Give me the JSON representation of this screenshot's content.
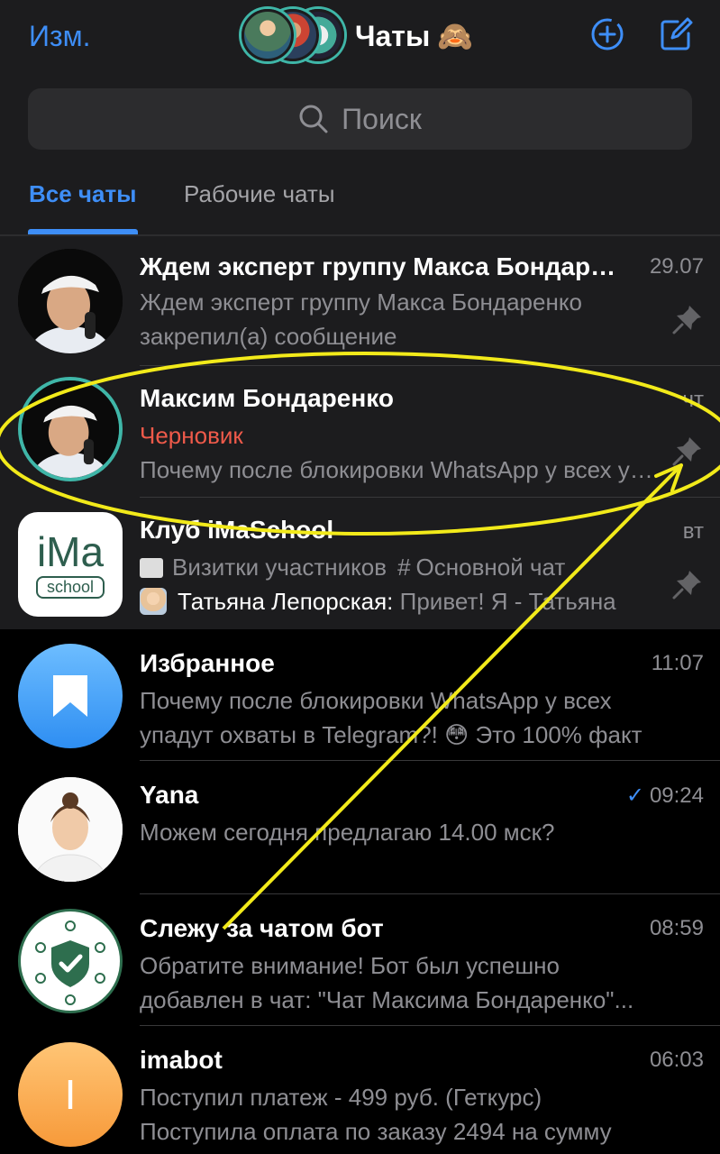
{
  "header": {
    "edit_label": "Изм.",
    "title": "Чаты",
    "title_emoji": "🙈"
  },
  "search": {
    "placeholder": "Поиск"
  },
  "tabs": [
    {
      "label": "Все чаты",
      "active": true
    },
    {
      "label": "Рабочие чаты",
      "active": false
    }
  ],
  "colors": {
    "accent": "#3e8ef7",
    "draft": "#ef5a4a",
    "highlight": "#f2ea1a"
  },
  "chats": [
    {
      "name": "Ждем эксперт группу Макса Бондаренко",
      "time": "29.07",
      "line1": "Ждем эксперт группу Макса Бондаренко",
      "line2": "закрепил(а) сообщение",
      "pinned": true
    },
    {
      "name": "Максим Бондаренко",
      "time": "чт",
      "draft_label": "Черновик",
      "line2": "Почему после блокировки WhatsApp у всех упадут охваты в Telegram?!",
      "pinned": true
    },
    {
      "name": "Клуб iMaSchool",
      "time": "вт",
      "topic1": "Визитки участников",
      "topic2": "Основной чат",
      "author": "Татьяна Лепорская:",
      "message": "Привет! Я - Татьяна",
      "avatar_text": "iMa",
      "avatar_sub": "school",
      "pinned": true
    },
    {
      "name": "Избранное",
      "time": "11:07",
      "line1": "Почему после блокировки WhatsApp у всех",
      "line2": "упадут охваты в Telegram?! 😳 Это 100% факт",
      "icon": "bookmark-icon"
    },
    {
      "name": "Yana",
      "time": "09:24",
      "line1": "Можем сегодня предлагаю 14.00 мск?",
      "read": true
    },
    {
      "name": "Слежу за чатом бот",
      "time": "08:59",
      "line1": "Обратите внимание! Бот был успешно",
      "line2": "добавлен в чат: \"Чат Максима Бондаренко\"..."
    },
    {
      "name": "imabot",
      "time": "06:03",
      "line1": "Поступил платеж - 499 руб. (Геткурс)",
      "line2": "Поступила оплата по заказу 2494 на сумму",
      "avatar_letter": "I"
    }
  ]
}
